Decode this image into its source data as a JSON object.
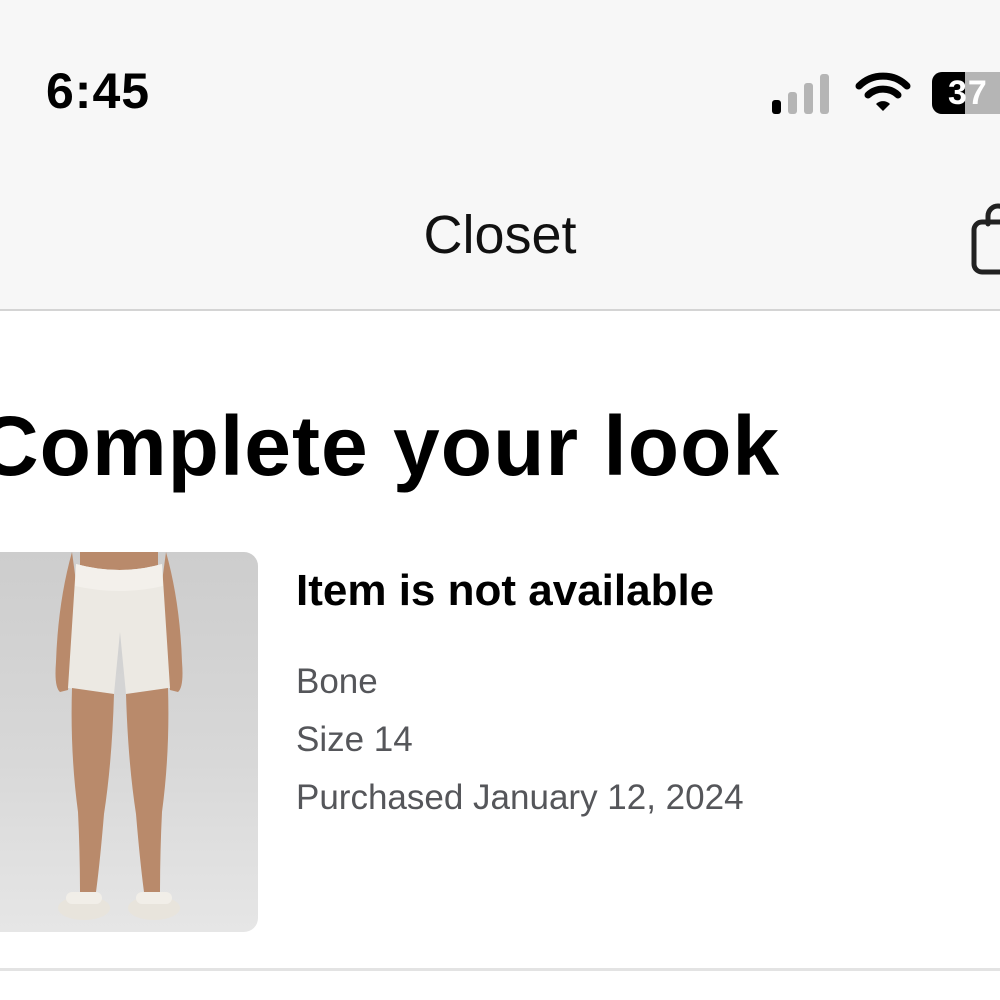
{
  "status_bar": {
    "time": "6:45",
    "battery_level": "37",
    "signal_icon": "cellular-signal-icon",
    "wifi_icon": "wifi-icon"
  },
  "header": {
    "title": "Closet",
    "bag_icon": "shopping-bag-icon"
  },
  "section": {
    "title": "Complete your look"
  },
  "product": {
    "name": "Item is not available",
    "color": "Bone",
    "size": "Size 14",
    "purchased": "Purchased January 12, 2024",
    "image_icon": "product-shorts-image"
  },
  "colors": {
    "header_bg": "#f7f7f7",
    "meta_text": "#55565a",
    "divider": "#d4d4d4"
  }
}
